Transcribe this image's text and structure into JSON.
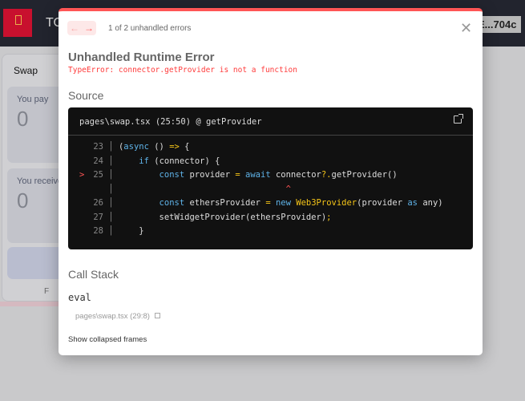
{
  "app": {
    "brand": "TO",
    "wallet": "E...704c",
    "logo_text": "TOPAZ WALLET"
  },
  "swap": {
    "title": "Swap",
    "pay_label": "You pay",
    "pay_value": "0",
    "receive_label": "You receive",
    "receive_value": "0",
    "footer": "F"
  },
  "overlay": {
    "counter": "1 of 2 unhandled errors",
    "title": "Unhandled Runtime Error",
    "error": "TypeError: connector.getProvider is not a function",
    "source_heading": "Source",
    "source_file": "pages\\swap.tsx (25:50) @ getProvider",
    "code": [
      {
        "num": "23",
        "mark": "",
        "tokens": [
          [
            "p",
            "("
          ],
          [
            "kw",
            "async"
          ],
          [
            "p",
            " () "
          ],
          [
            "op",
            "=>"
          ],
          [
            "p",
            " {"
          ]
        ]
      },
      {
        "num": "24",
        "mark": "",
        "tokens": [
          [
            "p",
            "    "
          ],
          [
            "kw",
            "if"
          ],
          [
            "p",
            " (connector) {"
          ]
        ]
      },
      {
        "num": "25",
        "mark": ">",
        "tokens": [
          [
            "p",
            "        "
          ],
          [
            "kw",
            "const"
          ],
          [
            "p",
            " provider "
          ],
          [
            "op",
            "="
          ],
          [
            "p",
            " "
          ],
          [
            "kw",
            "await"
          ],
          [
            "p",
            " connector"
          ],
          [
            "op",
            "?."
          ],
          [
            "p",
            "getProvider()"
          ]
        ]
      },
      {
        "num": "",
        "mark": "",
        "tokens": [
          [
            "p",
            "                                 "
          ],
          [
            "caret",
            "^"
          ]
        ]
      },
      {
        "num": "26",
        "mark": "",
        "tokens": [
          [
            "p",
            "        "
          ],
          [
            "kw",
            "const"
          ],
          [
            "p",
            " ethersProvider "
          ],
          [
            "op",
            "="
          ],
          [
            "p",
            " "
          ],
          [
            "kw",
            "new"
          ],
          [
            "p",
            " "
          ],
          [
            "fn",
            "Web3Provider"
          ],
          [
            "p",
            "(provider "
          ],
          [
            "kw",
            "as"
          ],
          [
            "p",
            " any)"
          ]
        ]
      },
      {
        "num": "27",
        "mark": "",
        "tokens": [
          [
            "p",
            "        setWidgetProvider(ethersProvider)"
          ],
          [
            "op",
            ";"
          ]
        ]
      },
      {
        "num": "28",
        "mark": "",
        "tokens": [
          [
            "p",
            "    }"
          ]
        ]
      }
    ],
    "callstack_heading": "Call Stack",
    "frame_fn": "eval",
    "frame_loc": "pages\\swap.tsx (29:8)",
    "show_collapsed": "Show collapsed frames"
  },
  "colors": {
    "accent": "#ff5555",
    "keyword": "#5fb3e8",
    "operator": "#f5c518"
  }
}
